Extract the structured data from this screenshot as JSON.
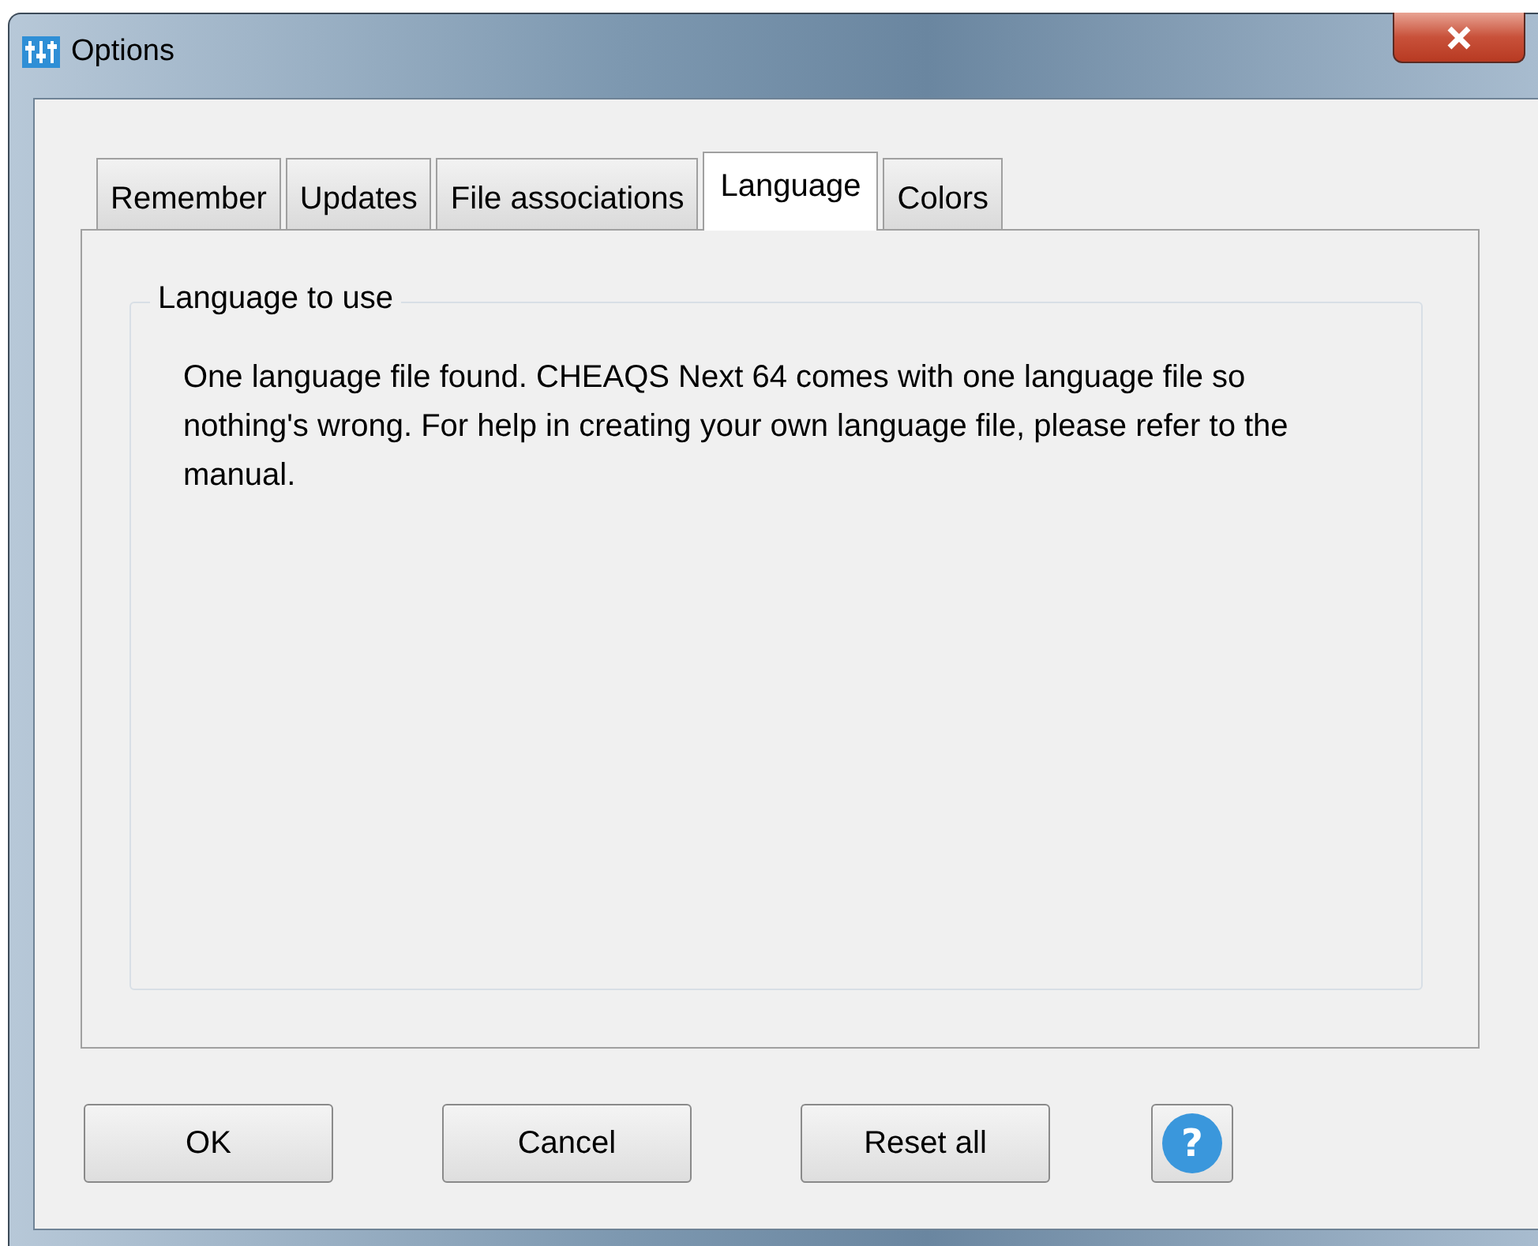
{
  "window": {
    "title": "Options"
  },
  "tabs": [
    {
      "label": "Remember",
      "selected": false
    },
    {
      "label": "Updates",
      "selected": false
    },
    {
      "label": "File associations",
      "selected": false
    },
    {
      "label": "Language",
      "selected": true
    },
    {
      "label": "Colors",
      "selected": false
    }
  ],
  "group": {
    "title": "Language to use",
    "message": "One language file found. CHEAQS Next 64 comes with one language file so nothing's wrong. For help in creating your own language file, please refer to the manual."
  },
  "buttons": [
    {
      "kind": "text",
      "label": "OK"
    },
    {
      "kind": "text",
      "label": "Cancel"
    },
    {
      "kind": "text",
      "label": "Reset all"
    },
    {
      "kind": "help",
      "glyph": "?"
    }
  ]
}
